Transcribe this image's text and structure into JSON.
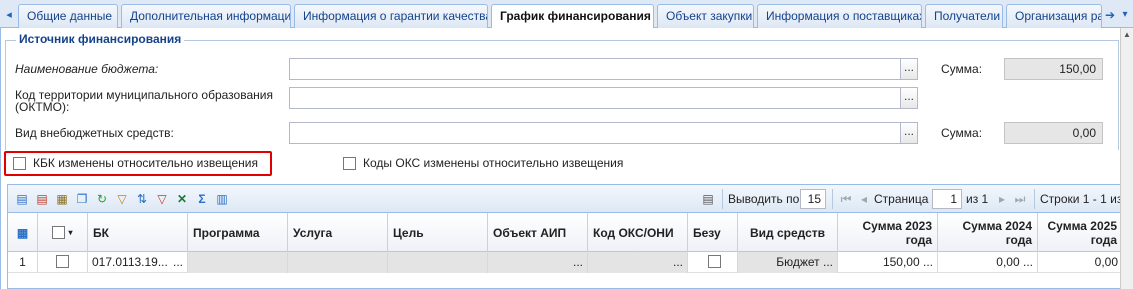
{
  "tabs": [
    {
      "label": "Общие данные"
    },
    {
      "label": "Дополнительная информация"
    },
    {
      "label": "Информация о гарантии качества"
    },
    {
      "label": "График финансирования"
    },
    {
      "label": "Объект закупки"
    },
    {
      "label": "Информация о поставщиках"
    },
    {
      "label": "Получатели"
    },
    {
      "label": "Организация раз"
    }
  ],
  "active_tab": "График финансирования",
  "funding_source": {
    "legend": "Источник финансирования",
    "budget_name_label": "Наименование бюджета:",
    "budget_name_value": "",
    "sum_label_1": "Сумма:",
    "sum_value_1": "150,00",
    "oktmo_label_line1": "Код территории муниципального образования",
    "oktmo_label_line2": "(ОКТМО):",
    "oktmo_value": "",
    "offbudget_label": "Вид внебюджетных средств:",
    "offbudget_value": "",
    "sum_label_2": "Сумма:",
    "sum_value_2": "0,00",
    "dots": "..."
  },
  "checkboxes": {
    "kbk_changed": "КБК изменены относительно извещения",
    "oks_changed": "Коды ОКС изменены относительно извещения"
  },
  "grid_toolbar": {
    "output_label": "Выводить по",
    "page_size": "15",
    "page_label": "Страница",
    "page_number": "1",
    "page_of": "из 1",
    "rows_info": "Строки 1 - 1 из"
  },
  "grid": {
    "columns": [
      "БК",
      "Программа",
      "Услуга",
      "Цель",
      "Объект АИП",
      "Код ОКС/ОНИ",
      "Безу",
      "Вид средств",
      "Сумма 2023 год",
      "Сумма 2024 год",
      "Сумма 2025 год"
    ],
    "col_sum_2023": [
      "Сумма 2023",
      "года"
    ],
    "col_sum_2024": [
      "Сумма 2024",
      "года"
    ],
    "col_sum_2025": [
      "Сумма 2025",
      "года"
    ],
    "rows": [
      {
        "num": "1",
        "bk": "017.0113.19...",
        "bk_dots": "...",
        "aip_dots": "...",
        "oks_dots": "...",
        "fund_type": "Бюджет ...",
        "sum_2023": "150,00 ...",
        "sum_2024": "0,00 ...",
        "sum_2025": "0,00"
      }
    ]
  },
  "colors": {
    "highlight_border": "#e00000",
    "tab_text": "#15428b",
    "frame": "#99bbe8"
  }
}
